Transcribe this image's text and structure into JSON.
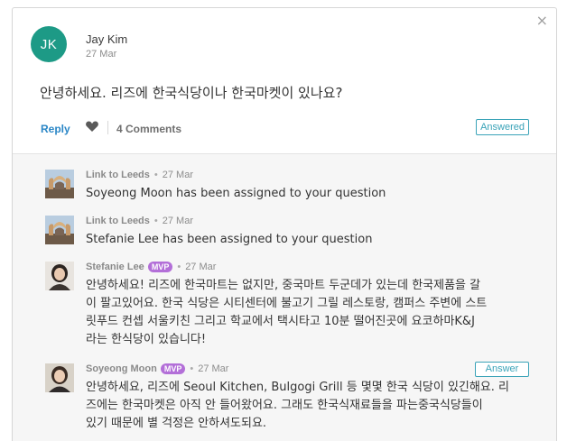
{
  "close_icon": "×",
  "question": {
    "avatar_initials": "JK",
    "avatar_color": "#1d9a86",
    "author": "Jay Kim",
    "date": "27 Mar",
    "text": "안녕하세요. 리즈에 한국식당이나 한국마켓이 있나요?",
    "reply_label": "Reply",
    "comments_label": "4 Comments",
    "status_badge": "Answered"
  },
  "comments": [
    {
      "author": "Link to Leeds",
      "date": "27 Mar",
      "text": "Soyeong Moon has been assigned to your question"
    },
    {
      "author": "Link to Leeds",
      "date": "27 Mar",
      "text": "Stefanie Lee has been assigned to your question"
    },
    {
      "author": "Stefanie Lee",
      "badge": "MVP",
      "date": "27 Mar",
      "lines": [
        "안녕하세요! 리즈에 한국마트는 없지만, 중국마트 두군데가 있는데 한국제품을 갈",
        "이 팔고있어요. 한국 식당은 시티센터에 불고기 그릴 레스토랑, 캠퍼스 주변에 스트",
        "릿푸드 컨셉 서울키친 그리고 학교에서 택시타고 10분 떨어진곳에 요코하마K&J",
        "라는 한식당이 있습니다!"
      ]
    },
    {
      "author": "Soyeong Moon",
      "badge": "MVP",
      "date": "27 Mar",
      "answer_label": "Answer",
      "lines": [
        "안녕하세요, 리즈에 Seoul Kitchen, Bulgogi Grill 등 몇몇 한국 식당이 있긴해요. 리",
        "즈에는 한국마켓은 아직 안 들어왔어요. 그래도 한국식재료들을 파는중국식당들이",
        "있기 때문에 별 걱정은 안하셔도되요."
      ]
    }
  ]
}
